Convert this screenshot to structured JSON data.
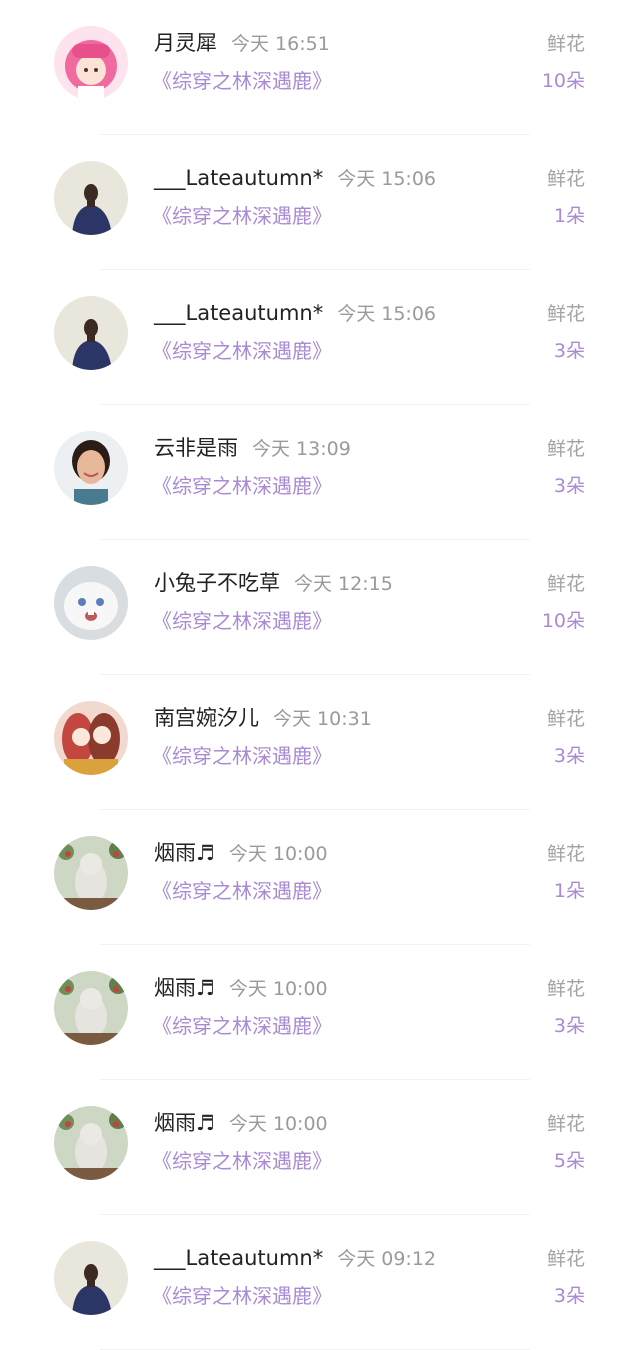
{
  "gift_label": "鲜花",
  "book_title": "《综穿之林深遇鹿》",
  "accent_color": "#a98ad3",
  "rows": [
    {
      "user": "月灵犀",
      "time": "今天 16:51",
      "count": "10朵",
      "avatar": "anime-pink-hair-avatar"
    },
    {
      "user": "___Lateautumn*",
      "time": "今天 15:06",
      "count": "1朵",
      "avatar": "girl-back-view-avatar"
    },
    {
      "user": "___Lateautumn*",
      "time": "今天 15:06",
      "count": "3朵",
      "avatar": "girl-back-view-avatar"
    },
    {
      "user": "云非是雨",
      "time": "今天 13:09",
      "count": "3朵",
      "avatar": "woman-photo-avatar"
    },
    {
      "user": "小兔子不吃草",
      "time": "今天 12:15",
      "count": "10朵",
      "avatar": "white-rabbit-avatar"
    },
    {
      "user": "南宫婉汐儿",
      "time": "今天 10:31",
      "count": "3朵",
      "avatar": "anime-couple-avatar"
    },
    {
      "user": "烟雨♬",
      "time": "今天 10:00",
      "count": "1朵",
      "avatar": "cat-flowers-avatar"
    },
    {
      "user": "烟雨♬",
      "time": "今天 10:00",
      "count": "3朵",
      "avatar": "cat-flowers-avatar"
    },
    {
      "user": "烟雨♬",
      "time": "今天 10:00",
      "count": "5朵",
      "avatar": "cat-flowers-avatar"
    },
    {
      "user": "___Lateautumn*",
      "time": "今天 09:12",
      "count": "3朵",
      "avatar": "girl-back-view-avatar"
    }
  ]
}
